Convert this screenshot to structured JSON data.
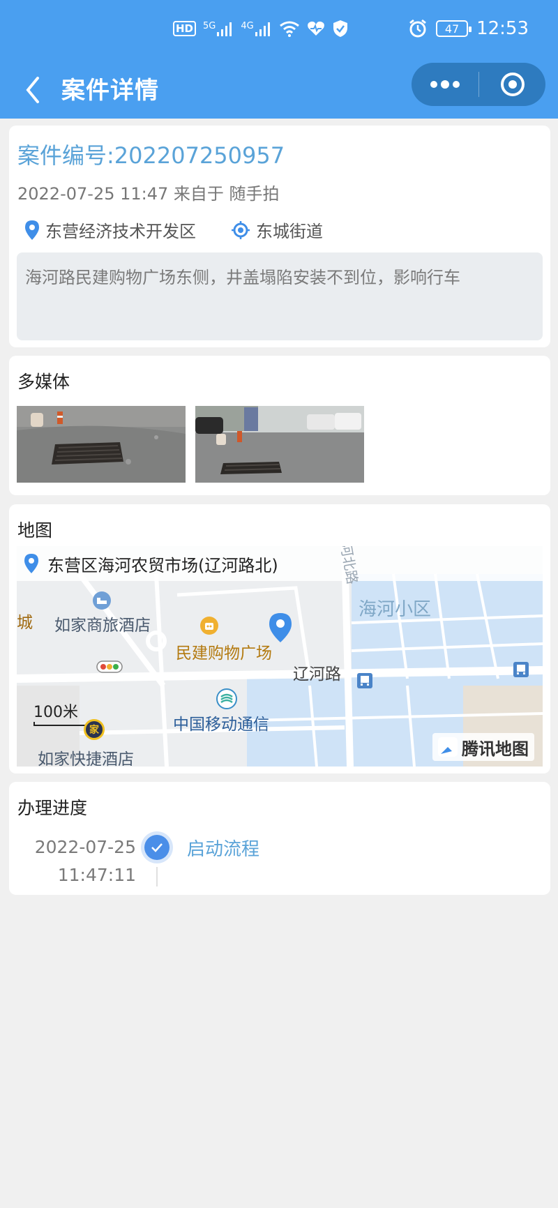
{
  "status_bar": {
    "network_hd": "HD",
    "network_5g": "5G",
    "network_4g": "4G",
    "battery": "47",
    "time": "12:53"
  },
  "nav": {
    "title": "案件详情",
    "back_icon": "chevron-left-icon",
    "more_icon": "more-dots-icon",
    "close_icon": "target-circle-icon"
  },
  "case": {
    "number": "案件编号:202207250957",
    "meta": "2022-07-25 11:47 来自于 随手拍",
    "district": "东营经济技术开发区",
    "street": "东城街道",
    "description": "海河路民建购物广场东侧，井盖塌陷安装不到位，影响行车"
  },
  "media": {
    "title": "多媒体"
  },
  "map": {
    "title": "地图",
    "address": "东营区海河农贸市场(辽河路北)",
    "labels": {
      "hotel1": "如家商旅酒店",
      "mall": "民建购物广场",
      "community": "海河小区",
      "road1": "辽河路",
      "road2": "河北路",
      "city": "城",
      "mobile": "中国移动通信",
      "hotel2": "如家快捷酒店",
      "hotel2_badge": "家"
    },
    "scale": "100米",
    "brand": "腾讯地图",
    "colors": {
      "water": "#cfe3f7",
      "marker": "#3f8ee8"
    }
  },
  "progress": {
    "title": "办理进度",
    "steps": [
      {
        "date": "2022-07-25",
        "time": "11:47:11",
        "label": "启动流程"
      }
    ]
  }
}
